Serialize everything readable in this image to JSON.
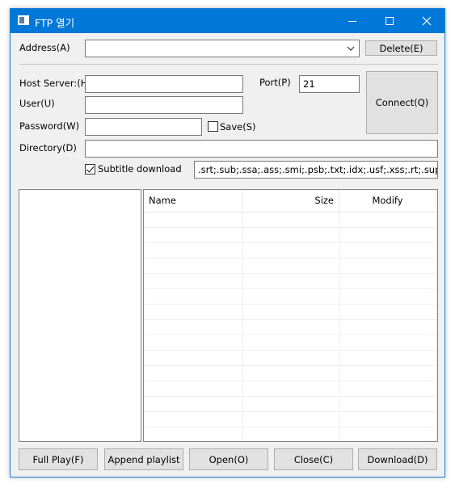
{
  "window": {
    "title": "FTP 열기",
    "controls": [
      "minimize-icon",
      "maximize-icon",
      "close-icon"
    ]
  },
  "address": {
    "label": "Address(A)",
    "value": "",
    "delete_button": "Delete(E)"
  },
  "connection": {
    "host_label": "Host Server:(H)",
    "host_value": "",
    "port_label": "Port(P)",
    "port_value": "21",
    "user_label": "User(U)",
    "user_value": "",
    "password_label": "Password(W)",
    "password_value": "",
    "save_label": "Save(S)",
    "save_checked": false,
    "connect_button": "Connect(Q)",
    "directory_label": "Directory(D)",
    "directory_value": "",
    "subtitle_label": "Subtitle download",
    "subtitle_checked": true,
    "subtitle_extensions": ".srt;.sub;.ssa;.ass;.smi;.psb;.txt;.idx;.usf;.xss;.rt;.sup"
  },
  "file_list": {
    "columns": [
      "Name",
      "Size",
      "Modify"
    ],
    "rows": []
  },
  "buttons": {
    "full_play": "Full Play(F)",
    "append_playlist": "Append playlist",
    "open": "Open(O)",
    "close": "Close(C)",
    "download": "Download(D)"
  }
}
